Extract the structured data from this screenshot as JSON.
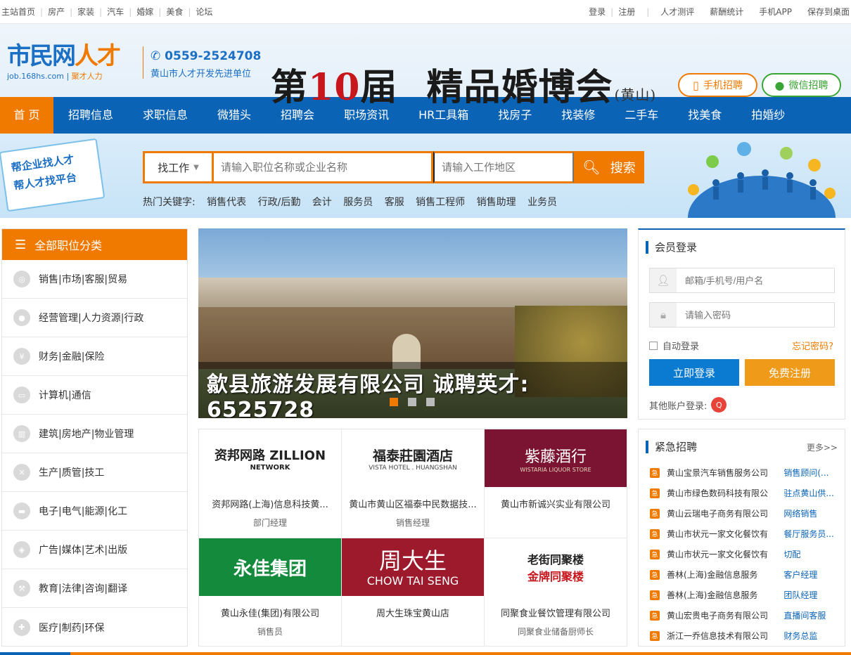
{
  "topbar": {
    "left": [
      "主站首页",
      "房产",
      "家装",
      "汽车",
      "婚嫁",
      "美食",
      "论坛"
    ],
    "right": [
      "登录",
      "注册",
      "人才测评",
      "薪酬统计",
      "手机APP",
      "保存到桌面"
    ]
  },
  "header": {
    "logo_main": "市民网",
    "logo_cai": "人才",
    "logo_url": "job.168hs.com",
    "logo_tag": "聚才人力",
    "phone": "0559-2524708",
    "unit": "黄山市人才开发先进单位",
    "banner_prefix": "第",
    "banner_num": "10",
    "banner_suffix": "届",
    "banner_main": "精品婚博会",
    "banner_sub": "(黄山)",
    "btn_mobile": "手机招聘",
    "btn_wechat": "微信招聘"
  },
  "nav": [
    "首 页",
    "招聘信息",
    "求职信息",
    "微猎头",
    "招聘会",
    "职场资讯",
    "HR工具箱",
    "找房子",
    "找装修",
    "二手车",
    "找美食",
    "拍婚纱"
  ],
  "search": {
    "flag_line1": "帮企业找人才",
    "flag_line2": "帮人才找平台",
    "type": "找工作",
    "kw_placeholder": "请输入职位名称或企业名称",
    "area_placeholder": "请输入工作地区",
    "go": "搜索",
    "hot_label": "热门关键字:",
    "hot": [
      "销售代表",
      "行政/后勤",
      "会计",
      "服务员",
      "客服",
      "销售工程师",
      "销售助理",
      "业务员"
    ]
  },
  "cats": {
    "title": "全部职位分类",
    "items": [
      "销售|市场|客服|贸易",
      "经营管理|人力资源|行政",
      "财务|金融|保险",
      "计算机|通信",
      "建筑|房地产|物业管理",
      "生产|质管|技工",
      "电子|电气|能源|化工",
      "广告|媒体|艺术|出版",
      "教育|法律|咨询|翻译",
      "医疗|制药|环保"
    ]
  },
  "slider": {
    "caption": "歙县旅游发展有限公司  诚聘英才: 6525728"
  },
  "companies": [
    {
      "logo": "资邦网路 ZILLION",
      "logo_sub": "NETWORK",
      "name": "资邦网路(上海)信息科技黄...",
      "pos": "部门经理"
    },
    {
      "logo": "福泰莊園酒店",
      "logo_sub": "VISTA HOTEL . HUANGSHAN",
      "name": "黄山市黄山区福泰中民数据技...",
      "pos": "销售经理"
    },
    {
      "logo": "紫藤酒行",
      "logo_sub": "WISTARIA LIQUOR STORE",
      "name": "黄山市新诚兴实业有限公司",
      "pos": ""
    },
    {
      "logo": "永佳集团",
      "logo_sub": "",
      "name": "黄山永佳(集团)有限公司",
      "pos": "销售员"
    },
    {
      "logo": "周大生",
      "logo_sub": "CHOW TAI SENG",
      "name": "周大生珠宝黄山店",
      "pos": ""
    },
    {
      "logo": "老街同聚楼",
      "logo_sub": "金牌同聚楼",
      "name": "同聚食业餐饮管理有限公司",
      "pos": "同聚食业储备厨师长"
    }
  ],
  "login": {
    "title": "会员登录",
    "user_placeholder": "邮箱/手机号/用户名",
    "pass_placeholder": "请输入密码",
    "auto": "自动登录",
    "forgot": "忘记密码?",
    "login_btn": "立即登录",
    "register_btn": "免费注册",
    "other": "其他账户登录:"
  },
  "urgent": {
    "title": "紧急招聘",
    "more": "更多>>",
    "items": [
      {
        "company": "黄山宝景汽车销售服务公司",
        "job": "销售顾问(..."
      },
      {
        "company": "黄山市绿色数码科技有限公",
        "job": "驻点黄山供..."
      },
      {
        "company": "黄山云瑞电子商务有限公司",
        "job": "网络销售"
      },
      {
        "company": "黄山市状元一家文化餐饮有",
        "job": "餐厅服务员..."
      },
      {
        "company": "黄山市状元一家文化餐饮有",
        "job": "切配"
      },
      {
        "company": "善林(上海)金融信息服务",
        "job": "客户经理"
      },
      {
        "company": "善林(上海)金融信息服务",
        "job": "团队经理"
      },
      {
        "company": "黄山宏贵电子商务有限公司",
        "job": "直播间客服"
      },
      {
        "company": "浙江一乔信息技术有限公司",
        "job": "财务总监"
      }
    ]
  },
  "colors": {
    "primary": "#0b63b6",
    "accent": "#f07a00",
    "green": "#39a534"
  }
}
